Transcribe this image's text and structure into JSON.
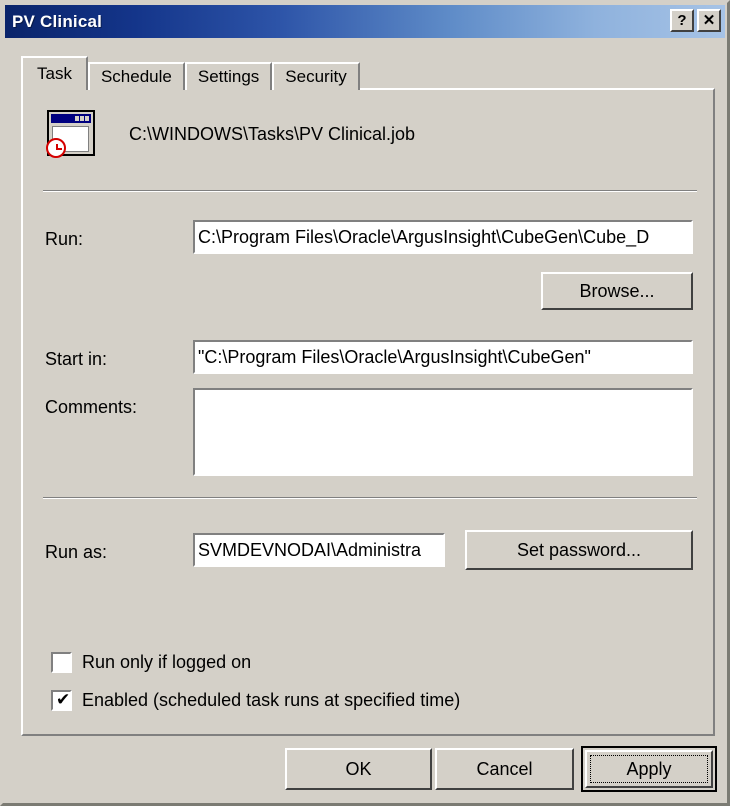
{
  "window": {
    "title": "PV Clinical",
    "help_button": "?",
    "close_button": "✕"
  },
  "tabs": [
    {
      "label": "Task",
      "active": true
    },
    {
      "label": "Schedule",
      "active": false
    },
    {
      "label": "Settings",
      "active": false
    },
    {
      "label": "Security",
      "active": false
    }
  ],
  "task": {
    "icon": "scheduled-task-icon",
    "path": "C:\\WINDOWS\\Tasks\\PV Clinical.job"
  },
  "fields": {
    "run_label": "Run:",
    "run_value": "C:\\Program Files\\Oracle\\ArgusInsight\\CubeGen\\Cube_D",
    "run_placeholder": "",
    "browse_label": "Browse...",
    "start_in_label": "Start in:",
    "start_in_value": "\"C:\\Program Files\\Oracle\\ArgusInsight\\CubeGen\"",
    "start_in_placeholder": "",
    "comments_label": "Comments:",
    "comments_value": "",
    "comments_placeholder": "",
    "run_as_label": "Run as:",
    "run_as_value": "SVMDEVNODAI\\Administra",
    "run_as_placeholder": "",
    "set_password_label": "Set password..."
  },
  "options": {
    "run_only_if_logged_on": {
      "label": "Run only if logged on",
      "checked": false,
      "mark": ""
    },
    "enabled": {
      "label": "Enabled (scheduled task runs at specified time)",
      "checked": true,
      "mark": "✔"
    }
  },
  "buttons": {
    "ok": "OK",
    "cancel": "Cancel",
    "apply": "Apply"
  },
  "colors": {
    "dialog_face": "#d4d0c8",
    "title_start": "#0a246a",
    "title_end": "#a6c3e6",
    "field_bg": "#ffffff",
    "icon_titlebar": "#000080",
    "clock_red": "#d40000"
  }
}
